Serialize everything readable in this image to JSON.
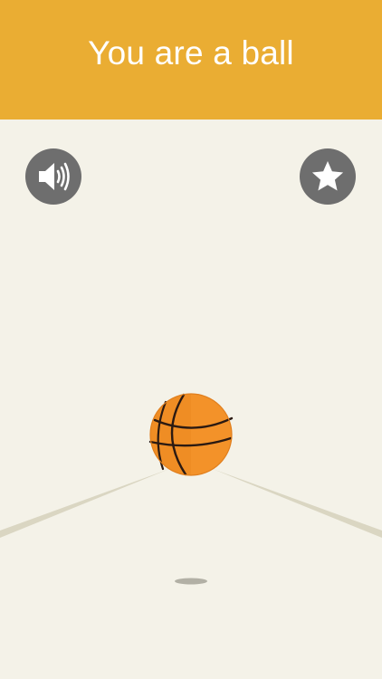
{
  "header": {
    "title": "You are a ball",
    "background": "#EAAD33"
  },
  "controls": {
    "sound_icon": "speaker-sound-on-icon",
    "star_icon": "star-icon",
    "button_color": "#6E6E6E"
  },
  "scene": {
    "background": "#F4F2E8",
    "ball_icon": "basketball-icon",
    "ball_color": "#F39229"
  }
}
